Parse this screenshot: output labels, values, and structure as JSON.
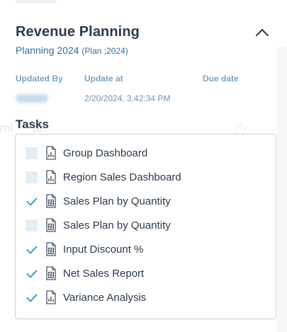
{
  "panel": {
    "title": "Revenue Planning",
    "plan_name": "Planning 2024",
    "plan_meta": "(Plan ;2024)",
    "collapse_icon": "chevron-up-icon"
  },
  "meta": {
    "updated_by_label": "Updated By",
    "updated_by_value": "",
    "update_at_label": "Update at",
    "update_at_value": "2/20/2024, 3:42:34 PM",
    "due_date_label": "Due date",
    "due_date_value": ""
  },
  "tasks": {
    "heading": "Tasks",
    "items": [
      {
        "label": "Group Dashboard",
        "checked": false,
        "icon": "chart-document-icon"
      },
      {
        "label": "Region Sales Dashboard",
        "checked": false,
        "icon": "chart-document-icon"
      },
      {
        "label": "Sales Plan by Quantity",
        "checked": true,
        "icon": "spreadsheet-document-icon"
      },
      {
        "label": "Sales Plan by Quantity",
        "checked": false,
        "icon": "spreadsheet-document-icon"
      },
      {
        "label": "Input Discount %",
        "checked": true,
        "icon": "spreadsheet-document-icon"
      },
      {
        "label": "Net Sales Report",
        "checked": true,
        "icon": "spreadsheet-document-icon"
      },
      {
        "label": "Variance Analysis",
        "checked": true,
        "icon": "chart-document-icon"
      }
    ]
  },
  "colors": {
    "title": "#2b3a4a",
    "accent": "#2f6fa3",
    "label": "#7ea1bf",
    "check": "#2f8fc2",
    "unchecked_fill": "#e4eef6",
    "border": "#c9d3dc"
  }
}
